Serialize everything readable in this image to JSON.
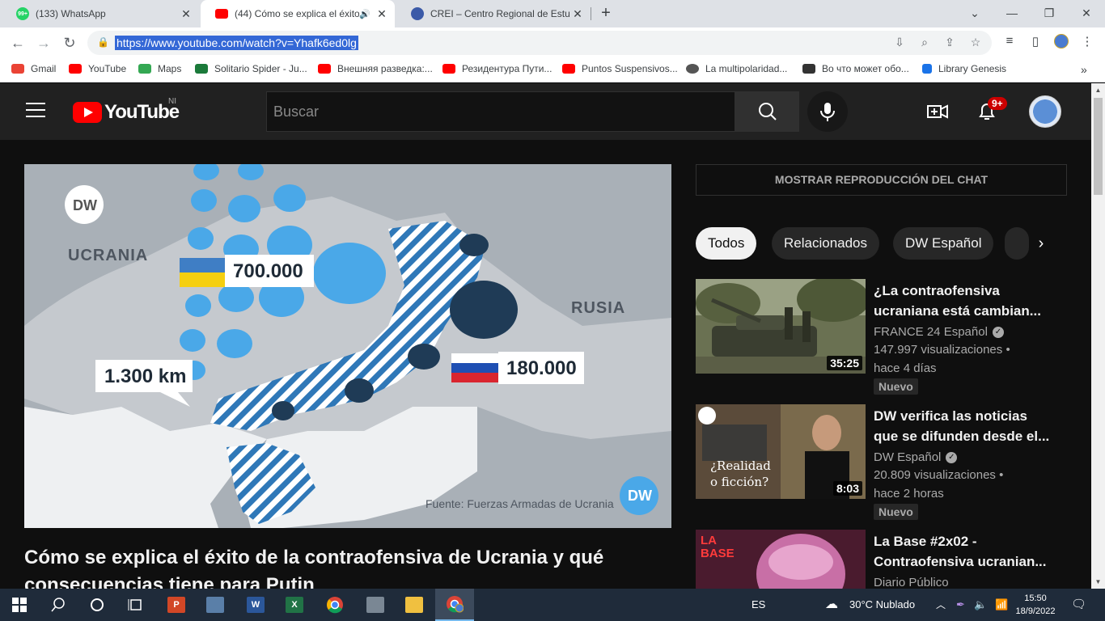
{
  "browser": {
    "tabs": [
      {
        "title": "(133) WhatsApp",
        "badge": "99+",
        "active": false
      },
      {
        "title": "(44) Cómo se explica el éxito",
        "active": true
      },
      {
        "title": "CREI – Centro Regional de Estud",
        "active": false
      }
    ],
    "url": "https://www.youtube.com/watch?v=Yhafk6ed0lg",
    "bookmarks": [
      "Gmail",
      "YouTube",
      "Maps",
      "Solitario Spider - Ju...",
      "Внешняя разведка:...",
      "Резидентура Пути...",
      "Puntos Suspensivos...",
      "La multipolaridad...",
      "Во что может обо...",
      "Library Genesis"
    ]
  },
  "youtube": {
    "logo_text": "YouTube",
    "country_code": "NI",
    "search_placeholder": "Buscar",
    "notif_count": "9+",
    "video": {
      "title": "Cómo se explica el éxito de la contraofensiva de Ucrania y qué consecuencias tiene para Putin",
      "map": {
        "label_ukraine": "UCRANIA",
        "label_russia": "RUSIA",
        "ukraine_troops": "700.000",
        "russia_troops": "180.000",
        "front_length": "1.300 km",
        "source": "Fuente: Fuerzas Armadas de Ucrania",
        "logo": "DW"
      }
    },
    "chat_button": "MOSTRAR REPRODUCCIÓN DEL CHAT",
    "chips": [
      "Todos",
      "Relacionados",
      "DW Español"
    ],
    "recommendations": [
      {
        "title": "¿La contraofensiva ucraniana está cambian...",
        "channel": "FRANCE 24 Español",
        "views": "147.997 visualizaciones •",
        "ago": "hace 4 días",
        "badge": "Nuevo",
        "duration": "35:25"
      },
      {
        "title": "DW verifica las noticias que se difunden desde el...",
        "channel": "DW Español",
        "views": "20.809 visualizaciones •",
        "ago": "hace 2 horas",
        "badge": "Nuevo",
        "duration": "8:03",
        "thumb_text": "¿Realidad o ficción?"
      },
      {
        "title": "La Base #2x02 - Contraofensiva ucranian...",
        "channel": "Diario Público",
        "thumb_text": "LA BASE"
      }
    ]
  },
  "taskbar": {
    "lang": "ES",
    "weather": "30°C  Nublado",
    "time": "15:50",
    "date": "18/9/2022"
  }
}
